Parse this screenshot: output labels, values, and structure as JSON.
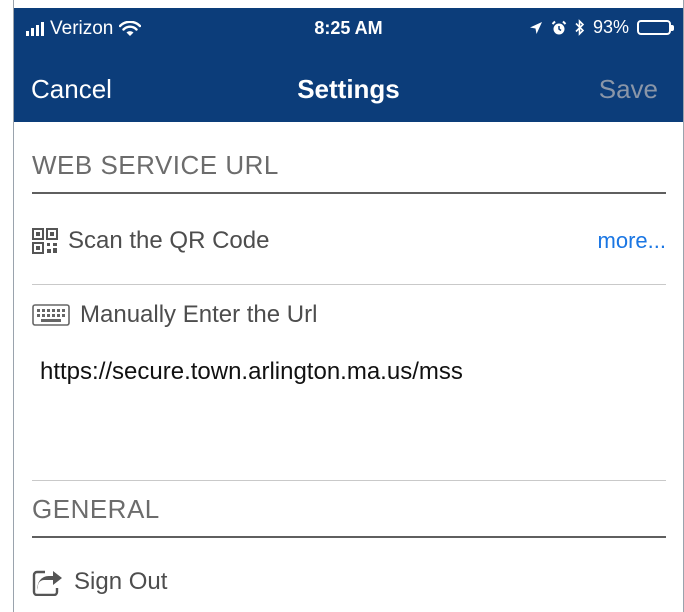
{
  "status_bar": {
    "carrier": "Verizon",
    "time": "8:25 AM",
    "battery": "93%",
    "battery_level": 0.93
  },
  "nav": {
    "cancel_label": "Cancel",
    "title": "Settings",
    "save_label": "Save"
  },
  "web_service": {
    "header": "WEB SERVICE URL",
    "scan_label": "Scan the QR Code",
    "more_label": "more...",
    "manual_label": "Manually Enter the Url",
    "url_value": "https://secure.town.arlington.ma.us/mss"
  },
  "general": {
    "header": "GENERAL",
    "sign_out_label": "Sign Out"
  },
  "colors": {
    "nav_background": "#0c3d7a",
    "link": "#1a76e3",
    "save_disabled": "#8a96a8"
  }
}
